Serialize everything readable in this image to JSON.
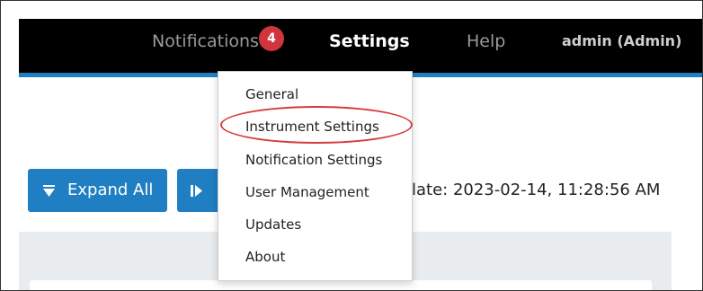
{
  "header": {
    "notifications_label": "Notifications",
    "notifications_badge": "4",
    "settings_label": "Settings",
    "help_label": "Help",
    "user_label": "admin (Admin)"
  },
  "toolbar": {
    "expand_all_label": "Expand All",
    "expand_icon": "triangle-down-icon",
    "second_icon": "play-bar-icon",
    "update_text": "late: 2023-02-14, 11:28:56 AM"
  },
  "settings_menu": {
    "items": [
      {
        "label": "General"
      },
      {
        "label": "Instrument Settings"
      },
      {
        "label": "Notification Settings"
      },
      {
        "label": "User Management"
      },
      {
        "label": "Updates"
      },
      {
        "label": "About"
      }
    ],
    "highlighted_index": 1
  },
  "colors": {
    "topbar": "#000000",
    "accent": "#1f7fc2",
    "badge": "#d0353f",
    "highlight": "#d63c3c",
    "panel": "#e9ecef"
  }
}
